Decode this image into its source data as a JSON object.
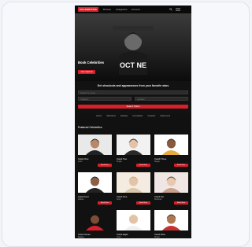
{
  "header": {
    "logo": "CELEBRITIES",
    "nav": [
      "Browse",
      "Categories",
      "Account"
    ]
  },
  "hero": {
    "title": "Book Celebrities",
    "button_label": "Get started",
    "shirt_text": "OCT NE"
  },
  "search": {
    "heading": "Get shoutouts and appearances from your favorite stars",
    "name_placeholder": "Search by name...",
    "category_placeholder": "Category",
    "location_placeholder": "Location",
    "button_label": "Search Talent"
  },
  "categories": [
    "Actors",
    "Musicians",
    "Athletes",
    "Comedians",
    "Creators",
    "Influencers"
  ],
  "grid": {
    "heading": "Featured Celebrities",
    "cards": [
      {
        "name": "Celeb One",
        "category": "Actor",
        "book_label": "Book Now",
        "bg": "#e9e9e9",
        "skin": "#b9876a",
        "hair": "#1a1a1a",
        "shirt": "#222222"
      },
      {
        "name": "Celeb Two",
        "category": "Singer",
        "book_label": "Book Now",
        "bg": "#f2f2f2",
        "skin": "#e2c2a8",
        "hair": "#1a1a1a",
        "shirt": "#2a2a2a"
      },
      {
        "name": "Celeb Three",
        "category": "Singer",
        "book_label": "Book Now",
        "bg": "#ffffff",
        "skin": "#8a5a3f",
        "hair": "#2e1a12",
        "shirt": "#e6aa40"
      },
      {
        "name": "Celeb Four",
        "category": "Athlete",
        "book_label": "Book Now",
        "bg": "#ffffff",
        "skin": "#8c5f47",
        "hair": "#111111",
        "shirt": "#222222"
      },
      {
        "name": "Celeb Five",
        "category": "Actor",
        "book_label": "Book Now",
        "bg": "#f4ece0",
        "skin": "#e4c4a8",
        "hair": "#c9a56a",
        "shirt": "#d9c7a9"
      },
      {
        "name": "Celeb Six",
        "category": "Musician",
        "book_label": "Book Now",
        "bg": "#f0e6e4",
        "skin": "#e8c8b0",
        "hair": "#4a2e20",
        "shirt": "#c8a08c"
      },
      {
        "name": "Celeb Seven",
        "category": "Rapper",
        "book_label": "Book Now",
        "bg": "#111111",
        "skin": "#7a4e36",
        "hair": "#111111",
        "shirt": "#d8202a"
      },
      {
        "name": "Celeb Eight",
        "category": "Actor",
        "book_label": "Book Now",
        "bg": "#ffffff",
        "skin": "#e2c2a8",
        "hair": "#e6d8a0",
        "shirt": "#f0f0f0"
      },
      {
        "name": "Celeb Nine",
        "category": "Singer",
        "book_label": "Book Now",
        "bg": "#ffffff",
        "skin": "#b07850",
        "hair": "#3a2416",
        "shirt": "#c83030"
      }
    ]
  },
  "colors": {
    "accent": "#d8202a"
  }
}
